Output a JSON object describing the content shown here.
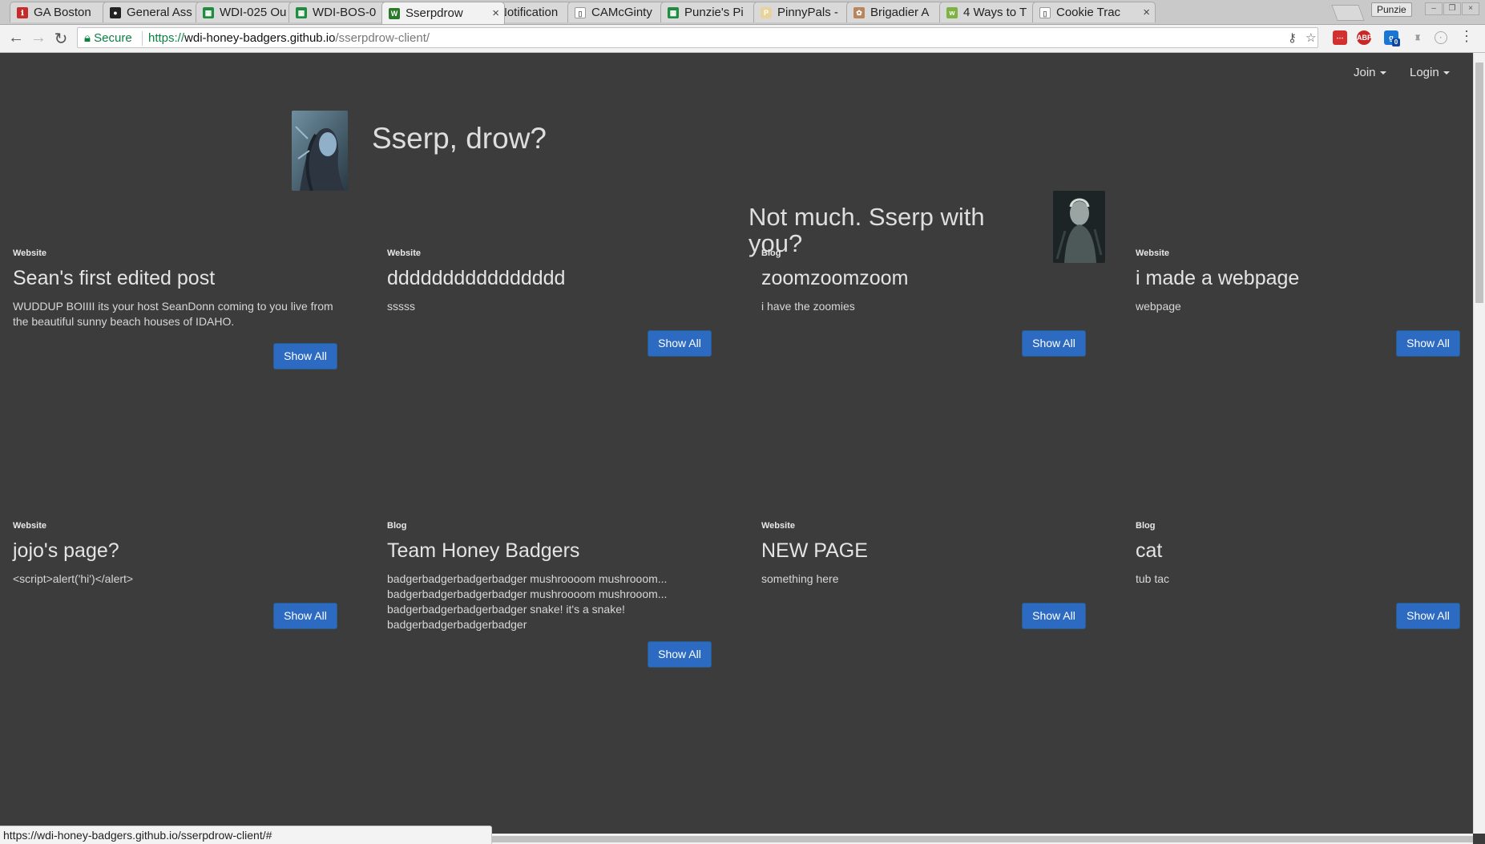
{
  "browser": {
    "tabs": [
      {
        "title": "GA Boston",
        "fav": "#c92a2a",
        "fav_text": "ℹ"
      },
      {
        "title": "General Ass",
        "fav": "#222222",
        "fav_text": "●"
      },
      {
        "title": "WDI-025 Ou",
        "fav": "#1e8e3e",
        "fav_text": "▦"
      },
      {
        "title": "WDI-BOS-0",
        "fav": "#1e8e3e",
        "fav_text": "▦"
      },
      {
        "title": "Sserpdrow",
        "fav": "#2a7a2a",
        "fav_text": "W"
      },
      {
        "title": "Notification",
        "fav": "#0a66c2",
        "fav_text": "in"
      },
      {
        "title": "CAMcGinty",
        "fav": "#ffffff",
        "fav_text": "▯"
      },
      {
        "title": "Punzie's Pi",
        "fav": "#1e8e3e",
        "fav_text": "▦"
      },
      {
        "title": "PinnyPals -",
        "fav": "#e8d49b",
        "fav_text": "P"
      },
      {
        "title": "Brigadier A",
        "fav": "#b8865b",
        "fav_text": "✿"
      },
      {
        "title": "4 Ways to T",
        "fav": "#7cb342",
        "fav_text": "w"
      },
      {
        "title": "Cookie Trac",
        "fav": "#ffffff",
        "fav_text": "▯"
      }
    ],
    "active_tab": 4,
    "close_glyph": "×",
    "profile": "Punzie",
    "secure_label": "Secure",
    "url_scheme": "https://",
    "url_host": "wdi-honey-badgers.github.io",
    "url_path": "/sserpdrow-client/",
    "status_url": "https://wdi-honey-badgers.github.io/sserpdrow-client/#",
    "ext_badge": "0"
  },
  "nav": {
    "join": "Join",
    "login": "Login"
  },
  "hero": {
    "question": "Sserp, drow?",
    "answer": "Not much. Sserp with you?"
  },
  "posts": [
    {
      "type": "Website",
      "title": "Sean's first edited post",
      "body": "WUDDUP BOIIII its your host SeanDonn coming to you live from the beautiful sunny beach houses of IDAHO.",
      "button": "Show All"
    },
    {
      "type": "Website",
      "title": "dddddddddddddddd",
      "body": "sssss",
      "button": "Show All"
    },
    {
      "type": "Blog",
      "title": "zoomzoomzoom",
      "body": "i have the zoomies",
      "button": "Show All"
    },
    {
      "type": "Website",
      "title": "i made a webpage",
      "body": "webpage",
      "button": "Show All"
    },
    {
      "type": "Website",
      "title": "jojo's page?",
      "body": "<script>alert('hi')</alert>",
      "button": "Show All"
    },
    {
      "type": "Blog",
      "title": "Team Honey Badgers",
      "body": "badgerbadgerbadgerbadger mushroooom mushrooom... badgerbadgerbadgerbadger mushroooom mushrooom... badgerbadgerbadgerbadger snake! it's a snake! badgerbadgerbadgerbadger",
      "button": "Show All"
    },
    {
      "type": "Website",
      "title": "NEW PAGE",
      "body": "something here",
      "button": "Show All"
    },
    {
      "type": "Blog",
      "title": "cat",
      "body": "tub tac",
      "button": "Show All"
    }
  ],
  "colors": {
    "page_bg": "#3c3c3c",
    "button_bg": "#2c6bc1",
    "secure_green": "#0b8043"
  }
}
